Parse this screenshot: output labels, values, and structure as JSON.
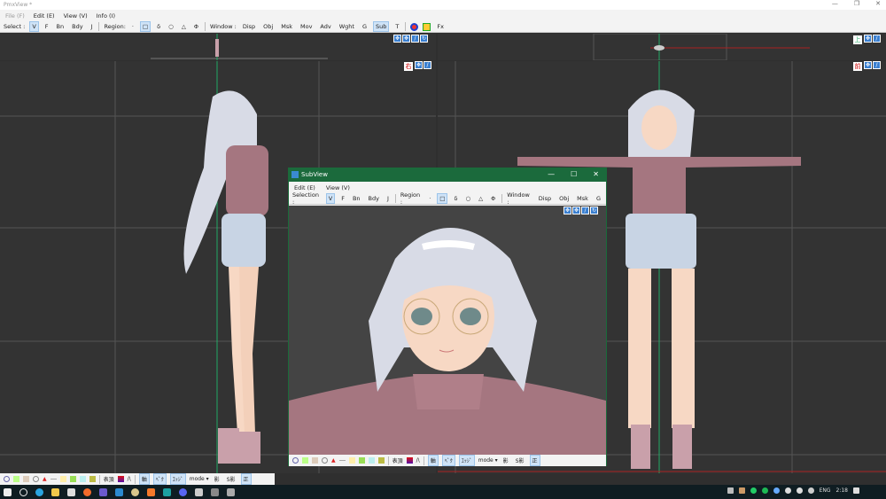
{
  "window": {
    "title": "PmxView *",
    "minimize": "—",
    "maximize": "❐",
    "close": "✕"
  },
  "menu": [
    "File (F)",
    "Edit (E)",
    "View (V)",
    "Info (I)"
  ],
  "toolbar": {
    "select_label": "Select :",
    "select_items": [
      "V",
      "F",
      "Bn",
      "Bdy",
      "J"
    ],
    "region_label": "Region:",
    "region_items": [
      "·",
      "□",
      "δ",
      "○",
      "△",
      "Φ"
    ],
    "window_label": "Window :",
    "window_items": [
      "Disp",
      "Obj",
      "Msk",
      "Mov",
      "Adv",
      "Wght",
      "G",
      "Sub",
      "T"
    ],
    "fx_label": "Fx"
  },
  "viewports": {
    "side_label": "右",
    "front_label": "前",
    "top_label": "上"
  },
  "subview": {
    "title": "SubView",
    "minimize": "—",
    "maximize": "☐",
    "close": "✕",
    "menu": [
      "Edit (E)",
      "View (V)"
    ],
    "selection_label": "Selection :",
    "selection_items": [
      "V",
      "F",
      "Bn",
      "Bdy",
      "J"
    ],
    "region_label": "Region :",
    "region_items": [
      "·",
      "□",
      "δ",
      "○",
      "△",
      "Φ"
    ],
    "window_label": "Window :",
    "window_items": [
      "Disp",
      "Obj",
      "Msk",
      "G"
    ]
  },
  "bottom_toolbar": {
    "items": [
      "表頂",
      "/\\",
      "軸",
      "ﾍﾞｸ",
      "ｴｯｼﾞ",
      "mode ▾",
      "影",
      "S影",
      "正"
    ]
  },
  "taskbar": {
    "tray": {
      "language": "ENG",
      "time": "2:18"
    }
  },
  "colors": {
    "accent": "#1b6a3c",
    "selected": "#cfe3f7",
    "viewport": "#333333",
    "sweater": "#a57680",
    "hair": "#d8dbe6",
    "skin": "#f7d8c4"
  }
}
